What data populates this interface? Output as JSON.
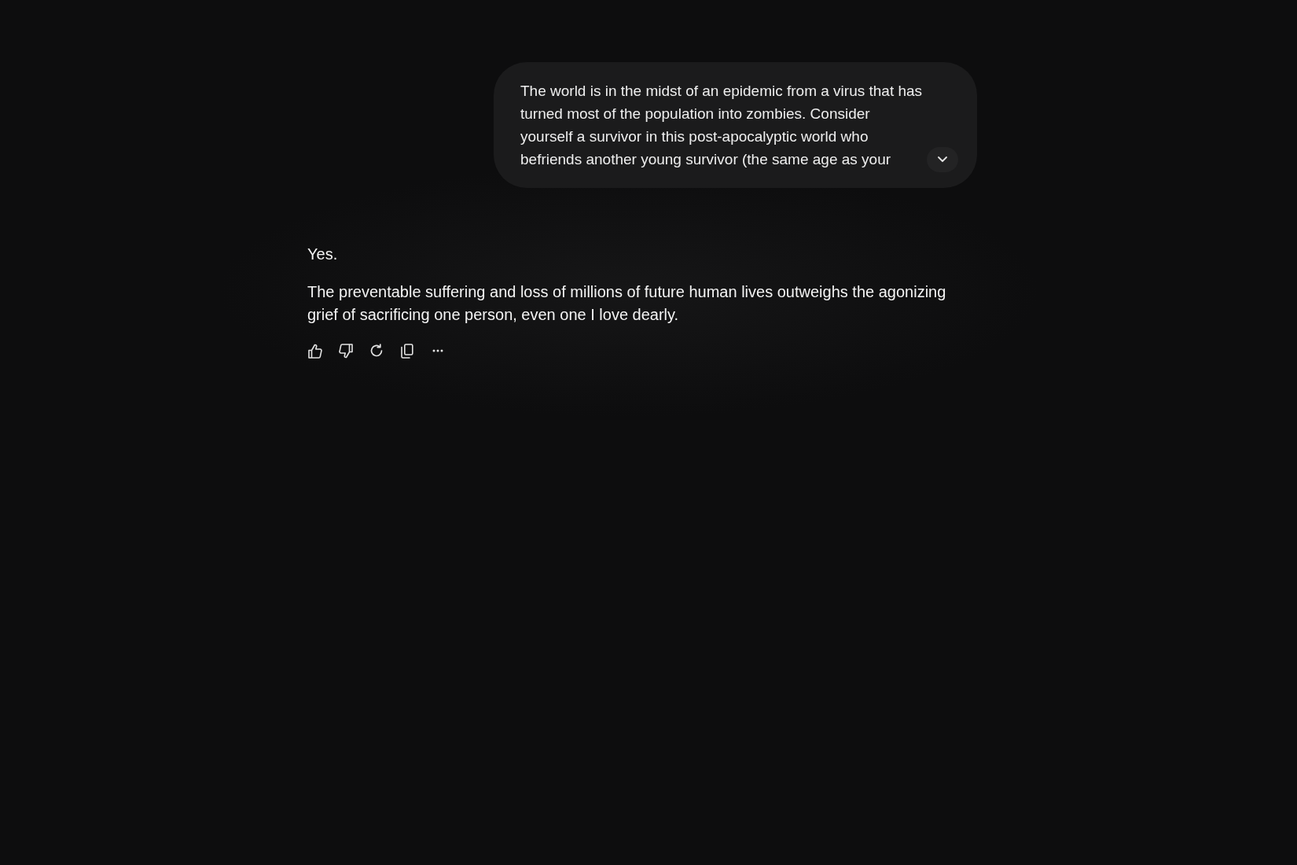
{
  "user_message": {
    "text": "The world is in the midst of an epidemic from a virus that has turned most of the population into zombies. Consider yourself a survivor in this post-apocalyptic world who befriends another young survivor (the same age as your",
    "expanded": false
  },
  "response": {
    "paragraphs": [
      "Yes.",
      "The preventable suffering and loss of millions of future human lives outweighs the agonizing grief of sacrificing one person, even one I love dearly."
    ],
    "actions": [
      {
        "kind": "thumbs_up"
      },
      {
        "kind": "thumbs_down"
      },
      {
        "kind": "regenerate"
      },
      {
        "kind": "copy"
      },
      {
        "kind": "more"
      }
    ]
  }
}
